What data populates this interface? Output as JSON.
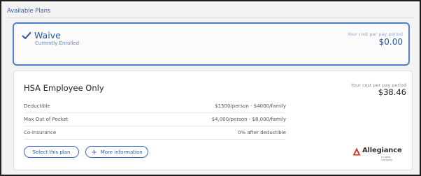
{
  "section": {
    "title": "Available Plans"
  },
  "waive": {
    "name": "Waive",
    "status": "Currently Enrolled",
    "cost_label": "Your cost per pay period",
    "cost_value": "$0.00",
    "icon": "checkmark-icon",
    "accent": "#4f7fcc"
  },
  "hsa": {
    "name": "HSA Employee Only",
    "cost_label": "Your cost per pay period",
    "cost_value": "$38.46",
    "details": [
      {
        "label": "Deductible",
        "value": "$1500/person - $4000/family"
      },
      {
        "label": "Max Out of Pocket",
        "value": "$4,000/person - $8,000/family"
      },
      {
        "label": "Co-Insurance",
        "value": "0% after deductible"
      }
    ],
    "select_label": "Select this plan",
    "more_label": "More information",
    "more_icon": "plus-icon",
    "logo": {
      "name": "Allegiance",
      "tagline": "a Cigna company",
      "icon": "allegiance-logo-icon",
      "color": "#d6302b"
    }
  }
}
